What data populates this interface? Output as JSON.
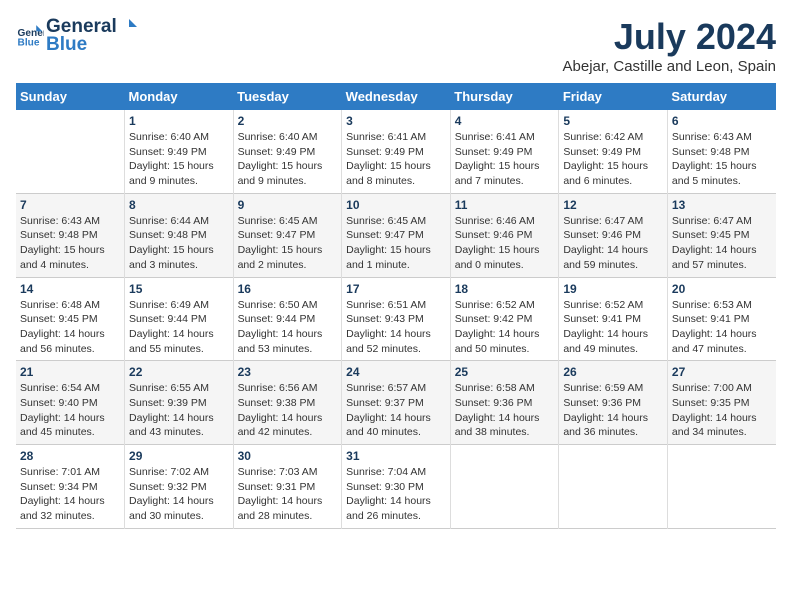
{
  "header": {
    "logo_general": "General",
    "logo_blue": "Blue",
    "month_year": "July 2024",
    "location": "Abejar, Castille and Leon, Spain"
  },
  "days_of_week": [
    "Sunday",
    "Monday",
    "Tuesday",
    "Wednesday",
    "Thursday",
    "Friday",
    "Saturday"
  ],
  "weeks": [
    [
      {
        "day": "",
        "sunrise": "",
        "sunset": "",
        "daylight": ""
      },
      {
        "day": "1",
        "sunrise": "Sunrise: 6:40 AM",
        "sunset": "Sunset: 9:49 PM",
        "daylight": "Daylight: 15 hours and 9 minutes."
      },
      {
        "day": "2",
        "sunrise": "Sunrise: 6:40 AM",
        "sunset": "Sunset: 9:49 PM",
        "daylight": "Daylight: 15 hours and 9 minutes."
      },
      {
        "day": "3",
        "sunrise": "Sunrise: 6:41 AM",
        "sunset": "Sunset: 9:49 PM",
        "daylight": "Daylight: 15 hours and 8 minutes."
      },
      {
        "day": "4",
        "sunrise": "Sunrise: 6:41 AM",
        "sunset": "Sunset: 9:49 PM",
        "daylight": "Daylight: 15 hours and 7 minutes."
      },
      {
        "day": "5",
        "sunrise": "Sunrise: 6:42 AM",
        "sunset": "Sunset: 9:49 PM",
        "daylight": "Daylight: 15 hours and 6 minutes."
      },
      {
        "day": "6",
        "sunrise": "Sunrise: 6:43 AM",
        "sunset": "Sunset: 9:48 PM",
        "daylight": "Daylight: 15 hours and 5 minutes."
      }
    ],
    [
      {
        "day": "7",
        "sunrise": "Sunrise: 6:43 AM",
        "sunset": "Sunset: 9:48 PM",
        "daylight": "Daylight: 15 hours and 4 minutes."
      },
      {
        "day": "8",
        "sunrise": "Sunrise: 6:44 AM",
        "sunset": "Sunset: 9:48 PM",
        "daylight": "Daylight: 15 hours and 3 minutes."
      },
      {
        "day": "9",
        "sunrise": "Sunrise: 6:45 AM",
        "sunset": "Sunset: 9:47 PM",
        "daylight": "Daylight: 15 hours and 2 minutes."
      },
      {
        "day": "10",
        "sunrise": "Sunrise: 6:45 AM",
        "sunset": "Sunset: 9:47 PM",
        "daylight": "Daylight: 15 hours and 1 minute."
      },
      {
        "day": "11",
        "sunrise": "Sunrise: 6:46 AM",
        "sunset": "Sunset: 9:46 PM",
        "daylight": "Daylight: 15 hours and 0 minutes."
      },
      {
        "day": "12",
        "sunrise": "Sunrise: 6:47 AM",
        "sunset": "Sunset: 9:46 PM",
        "daylight": "Daylight: 14 hours and 59 minutes."
      },
      {
        "day": "13",
        "sunrise": "Sunrise: 6:47 AM",
        "sunset": "Sunset: 9:45 PM",
        "daylight": "Daylight: 14 hours and 57 minutes."
      }
    ],
    [
      {
        "day": "14",
        "sunrise": "Sunrise: 6:48 AM",
        "sunset": "Sunset: 9:45 PM",
        "daylight": "Daylight: 14 hours and 56 minutes."
      },
      {
        "day": "15",
        "sunrise": "Sunrise: 6:49 AM",
        "sunset": "Sunset: 9:44 PM",
        "daylight": "Daylight: 14 hours and 55 minutes."
      },
      {
        "day": "16",
        "sunrise": "Sunrise: 6:50 AM",
        "sunset": "Sunset: 9:44 PM",
        "daylight": "Daylight: 14 hours and 53 minutes."
      },
      {
        "day": "17",
        "sunrise": "Sunrise: 6:51 AM",
        "sunset": "Sunset: 9:43 PM",
        "daylight": "Daylight: 14 hours and 52 minutes."
      },
      {
        "day": "18",
        "sunrise": "Sunrise: 6:52 AM",
        "sunset": "Sunset: 9:42 PM",
        "daylight": "Daylight: 14 hours and 50 minutes."
      },
      {
        "day": "19",
        "sunrise": "Sunrise: 6:52 AM",
        "sunset": "Sunset: 9:41 PM",
        "daylight": "Daylight: 14 hours and 49 minutes."
      },
      {
        "day": "20",
        "sunrise": "Sunrise: 6:53 AM",
        "sunset": "Sunset: 9:41 PM",
        "daylight": "Daylight: 14 hours and 47 minutes."
      }
    ],
    [
      {
        "day": "21",
        "sunrise": "Sunrise: 6:54 AM",
        "sunset": "Sunset: 9:40 PM",
        "daylight": "Daylight: 14 hours and 45 minutes."
      },
      {
        "day": "22",
        "sunrise": "Sunrise: 6:55 AM",
        "sunset": "Sunset: 9:39 PM",
        "daylight": "Daylight: 14 hours and 43 minutes."
      },
      {
        "day": "23",
        "sunrise": "Sunrise: 6:56 AM",
        "sunset": "Sunset: 9:38 PM",
        "daylight": "Daylight: 14 hours and 42 minutes."
      },
      {
        "day": "24",
        "sunrise": "Sunrise: 6:57 AM",
        "sunset": "Sunset: 9:37 PM",
        "daylight": "Daylight: 14 hours and 40 minutes."
      },
      {
        "day": "25",
        "sunrise": "Sunrise: 6:58 AM",
        "sunset": "Sunset: 9:36 PM",
        "daylight": "Daylight: 14 hours and 38 minutes."
      },
      {
        "day": "26",
        "sunrise": "Sunrise: 6:59 AM",
        "sunset": "Sunset: 9:36 PM",
        "daylight": "Daylight: 14 hours and 36 minutes."
      },
      {
        "day": "27",
        "sunrise": "Sunrise: 7:00 AM",
        "sunset": "Sunset: 9:35 PM",
        "daylight": "Daylight: 14 hours and 34 minutes."
      }
    ],
    [
      {
        "day": "28",
        "sunrise": "Sunrise: 7:01 AM",
        "sunset": "Sunset: 9:34 PM",
        "daylight": "Daylight: 14 hours and 32 minutes."
      },
      {
        "day": "29",
        "sunrise": "Sunrise: 7:02 AM",
        "sunset": "Sunset: 9:32 PM",
        "daylight": "Daylight: 14 hours and 30 minutes."
      },
      {
        "day": "30",
        "sunrise": "Sunrise: 7:03 AM",
        "sunset": "Sunset: 9:31 PM",
        "daylight": "Daylight: 14 hours and 28 minutes."
      },
      {
        "day": "31",
        "sunrise": "Sunrise: 7:04 AM",
        "sunset": "Sunset: 9:30 PM",
        "daylight": "Daylight: 14 hours and 26 minutes."
      },
      {
        "day": "",
        "sunrise": "",
        "sunset": "",
        "daylight": ""
      },
      {
        "day": "",
        "sunrise": "",
        "sunset": "",
        "daylight": ""
      },
      {
        "day": "",
        "sunrise": "",
        "sunset": "",
        "daylight": ""
      }
    ]
  ]
}
